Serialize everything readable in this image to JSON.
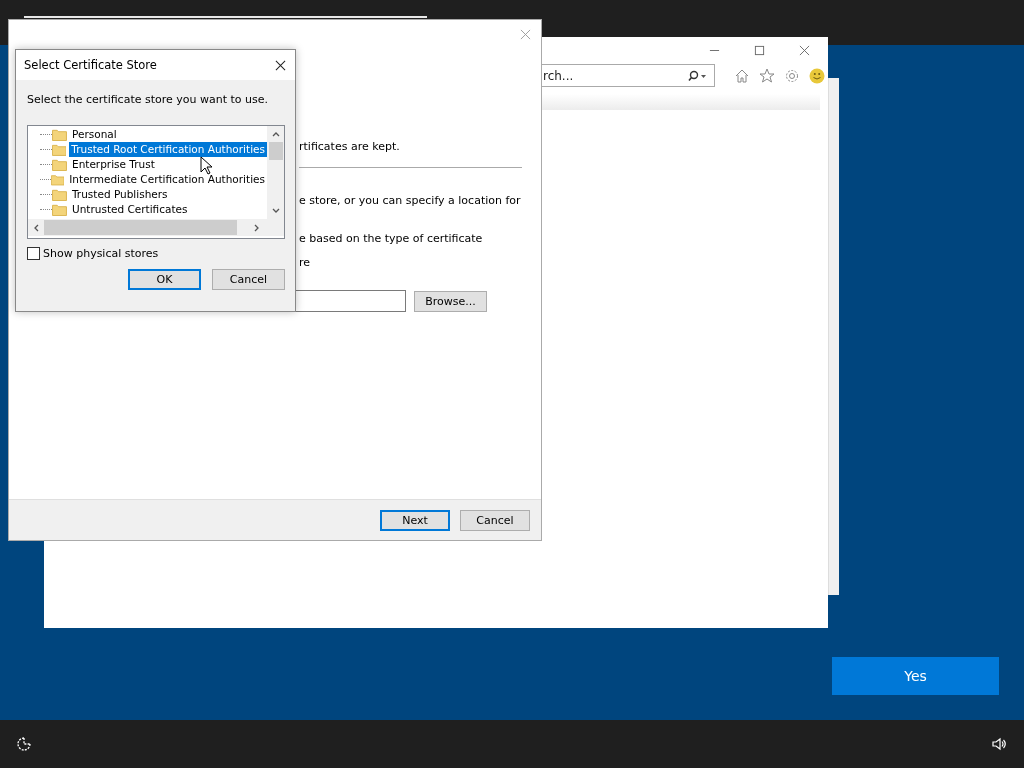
{
  "browser": {
    "search": {
      "placeholder": "rch..."
    }
  },
  "wizard": {
    "texts": [
      "rtificates are kept.",
      "e store, or you can specify a location for",
      "e based on the type of certificate",
      "re"
    ],
    "browse_button": "Browse...",
    "buttons": [
      {
        "label": "Next",
        "default": true
      },
      {
        "label": "Cancel",
        "default": false
      }
    ]
  },
  "dialog": {
    "title": "Select Certificate Store",
    "prompt": "Select the certificate store you want to use.",
    "stores": [
      {
        "label": "Personal",
        "selected": false
      },
      {
        "label": "Trusted Root Certification Authorities",
        "selected": true
      },
      {
        "label": "Enterprise Trust",
        "selected": false
      },
      {
        "label": "Intermediate Certification Authorities",
        "selected": false
      },
      {
        "label": "Trusted Publishers",
        "selected": false
      },
      {
        "label": "Untrusted Certificates",
        "selected": false
      }
    ],
    "show_physical": {
      "label": "Show physical stores",
      "checked": false
    },
    "buttons": [
      {
        "label": "OK",
        "default": true
      },
      {
        "label": "Cancel",
        "default": false
      }
    ]
  },
  "prompt_button": "Yes"
}
